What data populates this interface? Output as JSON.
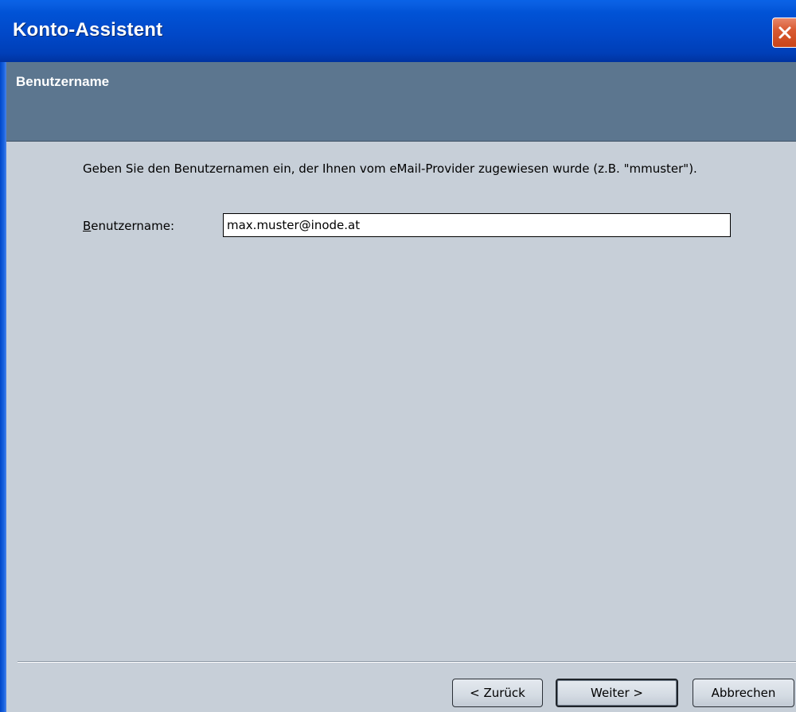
{
  "window": {
    "title": "Konto-Assistent"
  },
  "header": {
    "heading": "Benutzername"
  },
  "main": {
    "description": "Geben Sie den Benutzernamen ein, der Ihnen vom eMail-Provider zugewiesen wurde (z.B. \"mmuster\").",
    "username_label_accel": "B",
    "username_label_rest": "enutzername:",
    "username_value": "max.muster@inode.at"
  },
  "footer": {
    "back_label": "< Zurück",
    "next_label": "Weiter >",
    "cancel_label": "Abbrechen"
  },
  "icons": {
    "close": "close-icon"
  },
  "colors": {
    "titlebar": "#0153d6",
    "header_band": "#5c768f",
    "body_background": "#c7cfd8",
    "close_button": "#d95a32"
  }
}
